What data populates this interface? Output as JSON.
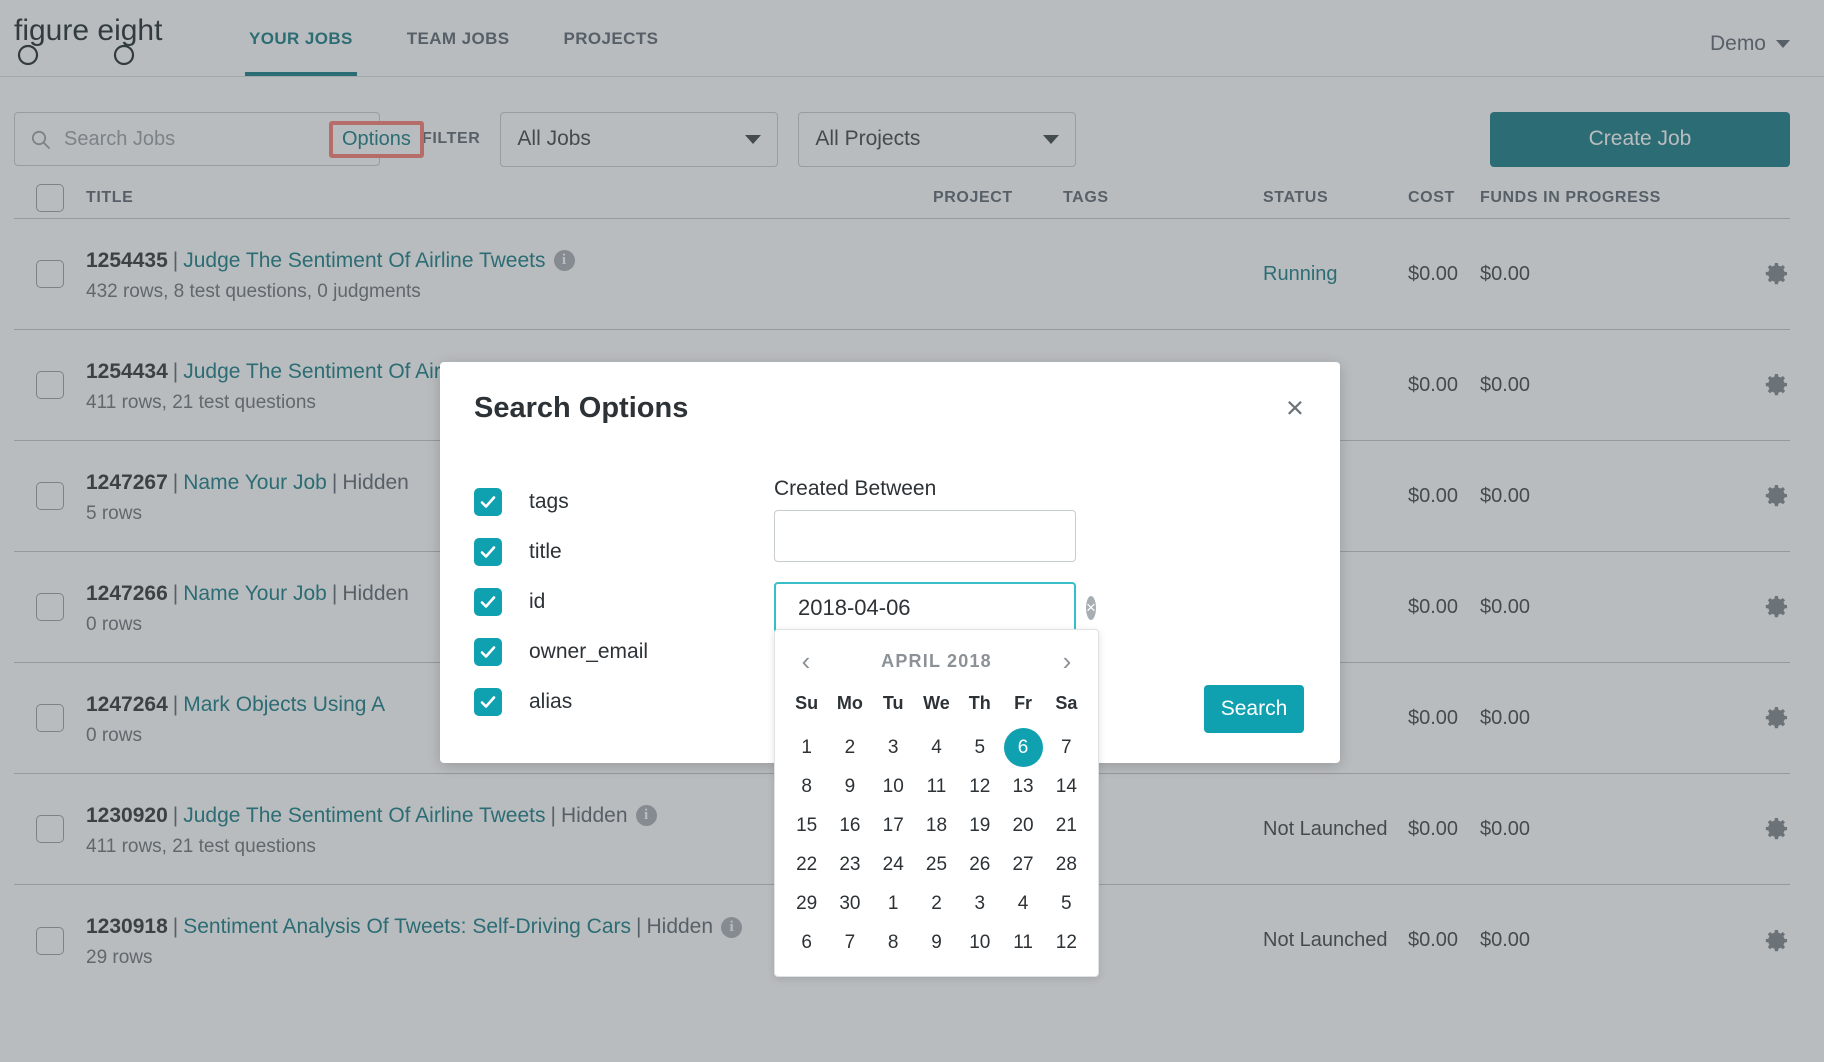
{
  "header": {
    "logo_text": "figure eight",
    "nav": [
      {
        "label": "YOUR JOBS",
        "active": true
      },
      {
        "label": "TEAM JOBS",
        "active": false
      },
      {
        "label": "PROJECTS",
        "active": false
      }
    ],
    "account_label": "Demo"
  },
  "toolbar": {
    "search_placeholder": "Search Jobs",
    "search_value": "",
    "options_label": "Options",
    "filter_label": "FILTER",
    "jobs_filter_value": "All Jobs",
    "projects_filter_value": "All Projects",
    "create_job_label": "Create Job"
  },
  "table": {
    "columns": {
      "title": "TITLE",
      "project": "PROJECT",
      "tags": "TAGS",
      "status": "STATUS",
      "cost": "COST",
      "funds": "FUNDS IN PROGRESS"
    },
    "rows": [
      {
        "id": "1254435",
        "title": "Judge The Sentiment Of Airline Tweets",
        "hidden": "",
        "has_info": true,
        "subtitle": "432 rows, 8 test questions, 0 judgments",
        "project": "",
        "tags": "",
        "status": "Running",
        "cost": "$0.00",
        "funds": "$0.00"
      },
      {
        "id": "1254434",
        "title": "Judge The Sentiment Of Airline Tweets",
        "hidden": "",
        "has_info": false,
        "subtitle": "411 rows, 21 test questions",
        "project": "",
        "tags": "",
        "status": "",
        "cost": "$0.00",
        "funds": "$0.00"
      },
      {
        "id": "1247267",
        "title": "Name Your Job",
        "hidden": "Hidden",
        "has_info": false,
        "subtitle": "5 rows",
        "project": "",
        "tags": "",
        "status": "",
        "cost": "$0.00",
        "funds": "$0.00"
      },
      {
        "id": "1247266",
        "title": "Name Your Job",
        "hidden": "Hidden",
        "has_info": false,
        "subtitle": "0 rows",
        "project": "",
        "tags": "",
        "status": "",
        "cost": "$0.00",
        "funds": "$0.00"
      },
      {
        "id": "1247264",
        "title": "Mark Objects Using A",
        "hidden": "",
        "has_info": false,
        "subtitle": "0 rows",
        "project": "",
        "tags": "",
        "status": "",
        "cost": "$0.00",
        "funds": "$0.00"
      },
      {
        "id": "1230920",
        "title": "Judge The Sentiment Of Airline Tweets",
        "hidden": "Hidden",
        "has_info": true,
        "subtitle": "411 rows, 21 test questions",
        "project": "",
        "tags": "",
        "status": "Not Launched",
        "cost": "$0.00",
        "funds": "$0.00"
      },
      {
        "id": "1230918",
        "title": "Sentiment Analysis Of Tweets: Self-Driving Cars",
        "hidden": "Hidden",
        "has_info": true,
        "subtitle": "29 rows",
        "project": "",
        "tags": "",
        "status": "Not Launched",
        "cost": "$0.00",
        "funds": "$0.00"
      }
    ]
  },
  "modal": {
    "title": "Search Options",
    "close_label": "×",
    "checkboxes": [
      {
        "label": "tags",
        "checked": true
      },
      {
        "label": "title",
        "checked": true
      },
      {
        "label": "id",
        "checked": true
      },
      {
        "label": "owner_email",
        "checked": true
      },
      {
        "label": "alias",
        "checked": true
      }
    ],
    "created_between_label": "Created Between",
    "date_from_value": "",
    "date_to_value": "2018-04-06",
    "clear_label": "×",
    "search_button_label": "Search",
    "calendar": {
      "prev_label": "‹",
      "next_label": "›",
      "month_label": "APRIL 2018",
      "weekdays": [
        "Su",
        "Mo",
        "Tu",
        "We",
        "Th",
        "Fr",
        "Sa"
      ],
      "selected_day": 6,
      "weeks": [
        [
          {
            "d": "1",
            "o": false
          },
          {
            "d": "2",
            "o": false
          },
          {
            "d": "3",
            "o": false
          },
          {
            "d": "4",
            "o": false
          },
          {
            "d": "5",
            "o": false
          },
          {
            "d": "6",
            "o": false
          },
          {
            "d": "7",
            "o": false
          }
        ],
        [
          {
            "d": "8",
            "o": false
          },
          {
            "d": "9",
            "o": false
          },
          {
            "d": "10",
            "o": false
          },
          {
            "d": "11",
            "o": false
          },
          {
            "d": "12",
            "o": false
          },
          {
            "d": "13",
            "o": false
          },
          {
            "d": "14",
            "o": false
          }
        ],
        [
          {
            "d": "15",
            "o": false
          },
          {
            "d": "16",
            "o": false
          },
          {
            "d": "17",
            "o": false
          },
          {
            "d": "18",
            "o": false
          },
          {
            "d": "19",
            "o": false
          },
          {
            "d": "20",
            "o": false
          },
          {
            "d": "21",
            "o": false
          }
        ],
        [
          {
            "d": "22",
            "o": false
          },
          {
            "d": "23",
            "o": false
          },
          {
            "d": "24",
            "o": false
          },
          {
            "d": "25",
            "o": false
          },
          {
            "d": "26",
            "o": false
          },
          {
            "d": "27",
            "o": false
          },
          {
            "d": "28",
            "o": false
          }
        ],
        [
          {
            "d": "29",
            "o": false
          },
          {
            "d": "30",
            "o": false
          },
          {
            "d": "1",
            "o": true
          },
          {
            "d": "2",
            "o": true
          },
          {
            "d": "3",
            "o": true
          },
          {
            "d": "4",
            "o": true
          },
          {
            "d": "5",
            "o": true
          }
        ],
        [
          {
            "d": "6",
            "o": true
          },
          {
            "d": "7",
            "o": true
          },
          {
            "d": "8",
            "o": true
          },
          {
            "d": "9",
            "o": true
          },
          {
            "d": "10",
            "o": true
          },
          {
            "d": "11",
            "o": true
          },
          {
            "d": "12",
            "o": true
          }
        ]
      ]
    }
  },
  "colors": {
    "brand_teal": "#147b84",
    "accent_cyan": "#10a1b0",
    "highlight_red": "#fb7a72",
    "text_dark": "#2d3236",
    "text_muted": "#5c6670"
  }
}
